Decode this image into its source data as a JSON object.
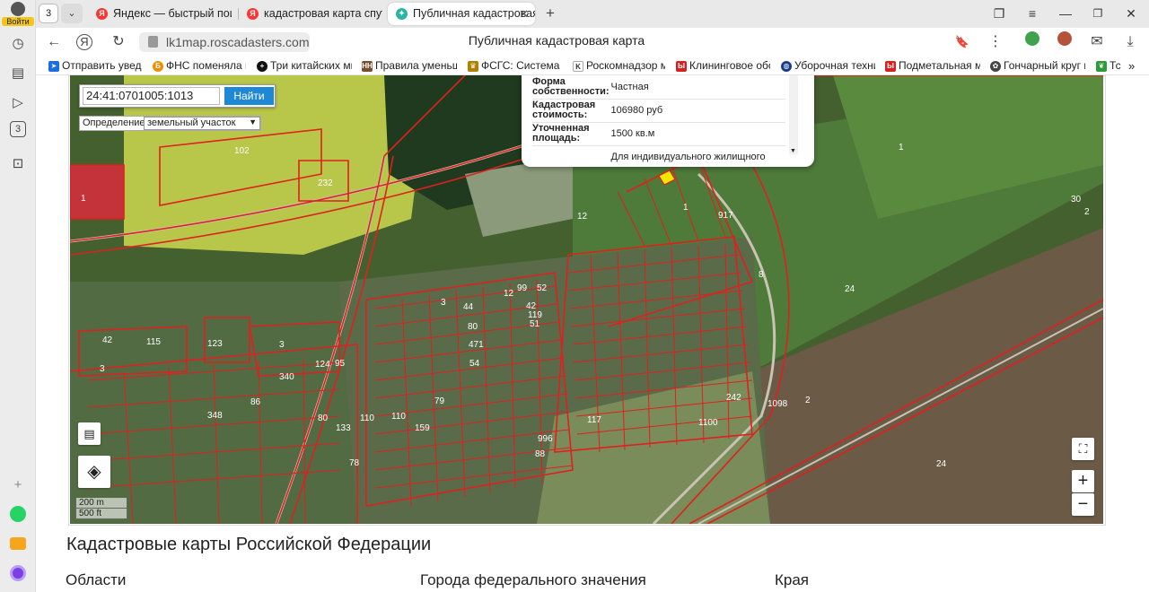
{
  "rail": {
    "login_label": "Войти",
    "tab_counter": "3"
  },
  "tabs": [
    {
      "title": "Яндекс — быстрый поиск",
      "favicon": "Я",
      "active": false
    },
    {
      "title": "кадастровая карта спутник",
      "favicon": "Я",
      "active": false
    },
    {
      "title": "Публичная кадастровая",
      "favicon": "✦",
      "active": true
    }
  ],
  "address": {
    "url": "lk1map.roscadasters.com",
    "page_title": "Публичная кадастровая карта"
  },
  "bookmarks": [
    {
      "label": "Отправить уведомление",
      "icon": "arrow-icon",
      "color": "#1e6de0"
    },
    {
      "label": "ФНС поменяла правила",
      "icon": "fns-icon",
      "color": "#f08c00"
    },
    {
      "label": "Три китайских миллиардера",
      "icon": "plus-circle-icon",
      "color": "#111111"
    },
    {
      "label": "Правила уменьшения",
      "icon": "nn-icon",
      "color": "#7a4e2d"
    },
    {
      "label": "ФСГС: Система сбора",
      "icon": "emblem-icon",
      "color": "#b08000"
    },
    {
      "label": "Роскомнадзор может",
      "icon": "k-icon",
      "color": "#333333"
    },
    {
      "label": "Клининговое оборудование",
      "icon": "vk-icon",
      "color": "#d22222"
    },
    {
      "label": "Уборочная техника",
      "icon": "globe-icon",
      "color": "#1a3a8a"
    },
    {
      "label": "Подметальная машина",
      "icon": "vk-icon",
      "color": "#d22222"
    },
    {
      "label": "Гончарный круг купить",
      "icon": "pin-icon",
      "color": "#444444"
    },
    {
      "label": "Тс",
      "icon": "leaf-icon",
      "color": "#2a9d3a"
    }
  ],
  "map": {
    "search_value": "24:41:0701005:1013",
    "search_button": "Найти",
    "definition_label": "Определение:",
    "definition_value": "земельный участок",
    "popup_rows": [
      {
        "key": "Форма собственности:",
        "value": "Частная"
      },
      {
        "key": "Кадастровая стоимость:",
        "value": "106980 руб"
      },
      {
        "key": "Уточненная площадь:",
        "value": "1500 кв.м"
      },
      {
        "key": "",
        "value": "Для индивидуального жилищного"
      }
    ],
    "scale_metric": "200 m",
    "scale_imperial": "500 ft",
    "zoom_in": "+",
    "zoom_out": "−",
    "parcel_labels": [
      "1",
      "102",
      "232",
      "42",
      "115",
      "123",
      "3",
      "340",
      "348",
      "86",
      "124",
      "110",
      "80",
      "133",
      "110",
      "79",
      "159",
      "117",
      "996",
      "88",
      "242",
      "1100",
      "1098",
      "2",
      "1",
      "24",
      "24",
      "30",
      "2",
      "1",
      "917",
      "3",
      "44",
      "80",
      "471",
      "12",
      "42",
      "119",
      "95",
      "78",
      "51",
      "99",
      "54",
      "12",
      "52",
      "8",
      "3",
      "17"
    ]
  },
  "page": {
    "heading": "Кадастровые карты Российской Федерации",
    "columns": [
      "Области",
      "Города федерального значения",
      "Края"
    ]
  }
}
